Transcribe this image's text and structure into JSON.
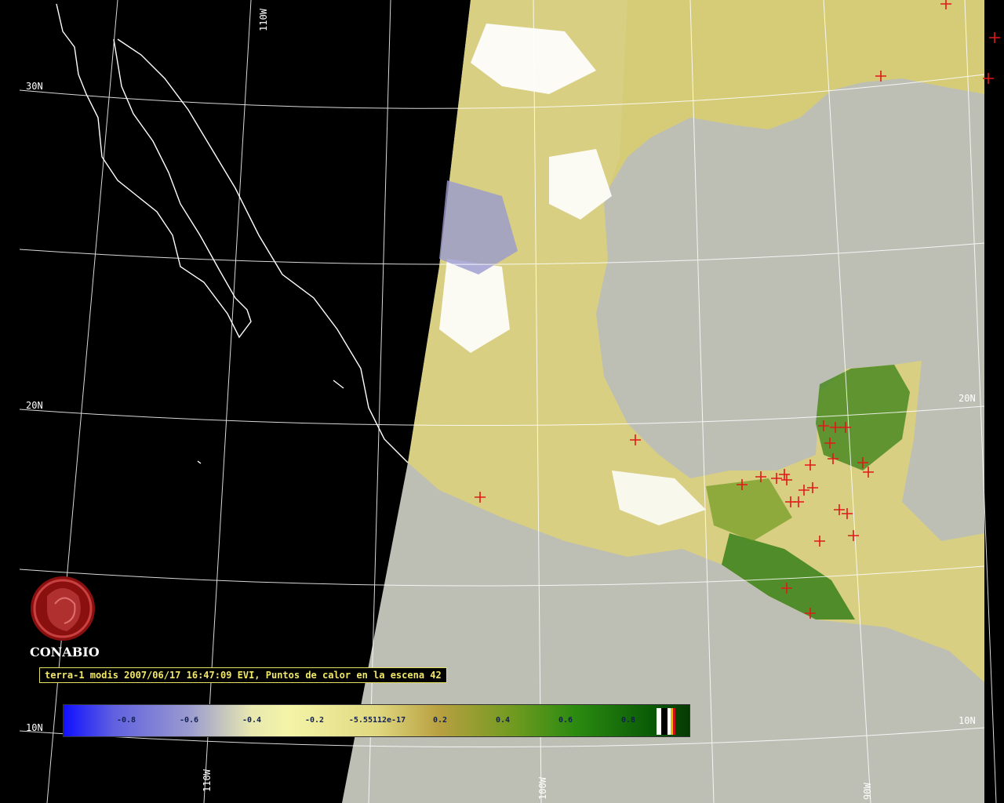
{
  "map": {
    "caption": "terra-1 modis 2007/06/17 16:47:09 EVI, Puntos de calor en la escena 42",
    "logo_label": "CONABIO",
    "grid_labels": {
      "lat_30n": "30N",
      "lat_20n_left": "20N",
      "lat_20n_right": "20N",
      "lat_10n_left": "10N",
      "lat_10n_right": "10N",
      "lon_110w_top": "110W",
      "lon_110w_bottom": "110W",
      "lon_100w_bottom": "100W",
      "lon_90w_bottom": "90W"
    },
    "colors": {
      "background": "#000000",
      "ocean": "#bdbfb5",
      "coastline": "#ffffff",
      "hotspot": "#e01818",
      "caption_text": "#f0e868"
    },
    "colorbar": {
      "ticks": [
        "-0.8",
        "-0.6",
        "-0.4",
        "-0.2",
        "-5.55112e-17",
        "0.2",
        "0.4",
        "0.6",
        "0.8"
      ],
      "extra_swatches": [
        "#ffffff",
        "#000000",
        "#ffffff",
        "#e0c000",
        "#d01010"
      ]
    }
  }
}
